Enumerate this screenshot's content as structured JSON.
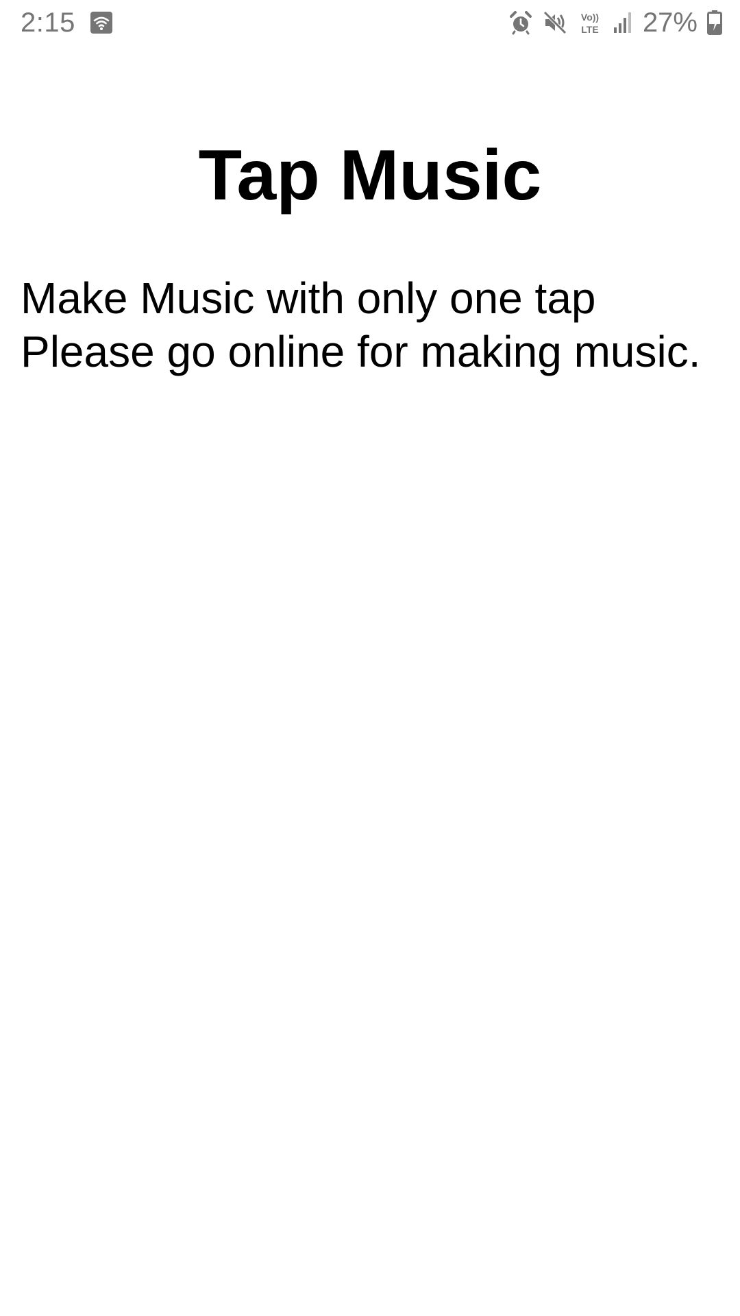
{
  "status_bar": {
    "time": "2:15",
    "notification_icon": "wifi-calling-icon",
    "icons": [
      "alarm-icon",
      "mute-icon",
      "volte-icon",
      "signal-icon"
    ],
    "volte_label_top": "Vo))",
    "volte_label_bottom": "LTE",
    "battery_percent": "27%",
    "battery_icon": "battery-charging-icon"
  },
  "app": {
    "title": "Tap Music",
    "tagline": "Make Music with only one tap",
    "message": "Please go online for making music."
  },
  "colors": {
    "background": "#ffffff",
    "text": "#000000",
    "status_text": "#757575"
  }
}
